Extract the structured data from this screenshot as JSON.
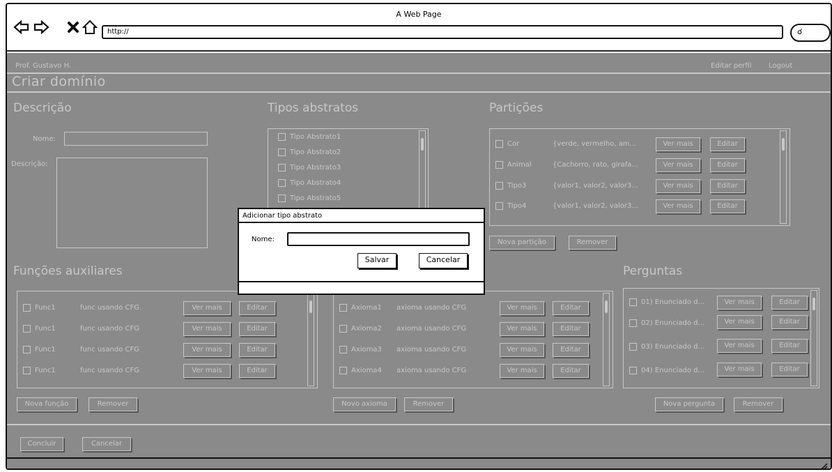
{
  "browser": {
    "title": "A Web Page",
    "url": "http://",
    "icons": [
      "back-arrow-icon",
      "forward-arrow-icon",
      "close-icon",
      "home-icon",
      "search-icon"
    ]
  },
  "header": {
    "user": "Prof. Gustavo H.",
    "edit_profile": "Editar perfil",
    "logout": "Logout"
  },
  "page": {
    "title": "Criar domínio"
  },
  "descricao": {
    "heading": "Descrição",
    "name_label": "Nome:",
    "desc_label": "Descrição:"
  },
  "tipos": {
    "heading": "Tipos abstratos",
    "items": [
      "Tipo Abstrato1",
      "Tipo Abstrato2",
      "Tipo Abstrato3",
      "Tipo Abstrato4",
      "Tipo Abstrato5"
    ]
  },
  "particoes": {
    "heading": "Partições",
    "items": [
      {
        "name": "Cor",
        "values": "{verde, vermelho, am...",
        "more": "Ver mais",
        "edit": "Editar"
      },
      {
        "name": "Animal",
        "values": "{Cachorro, rato, girafa...",
        "more": "Ver mais",
        "edit": "Editar"
      },
      {
        "name": "Tipo3",
        "values": "{valor1, valor2, valor3...",
        "more": "Ver mais",
        "edit": "Editar"
      },
      {
        "name": "Tipo4",
        "values": "{valor1, valor2, valor3...",
        "more": "Ver mais",
        "edit": "Editar"
      }
    ],
    "new_button": "Nova partição",
    "remove_button": "Remover"
  },
  "funcoes": {
    "heading": "Funções auxiliares",
    "items": [
      {
        "name": "Func1",
        "desc": "func usando CFG",
        "more": "Ver mais",
        "edit": "Editar"
      },
      {
        "name": "Func1",
        "desc": "func usando CFG",
        "more": "Ver mais",
        "edit": "Editar"
      },
      {
        "name": "Func1",
        "desc": "func usando CFG",
        "more": "Ver mais",
        "edit": "Editar"
      },
      {
        "name": "Func1",
        "desc": "func usando CFG",
        "more": "Ver mais",
        "edit": "Editar"
      }
    ],
    "new_button": "Nova função",
    "remove_button": "Remover"
  },
  "axiomas": {
    "items": [
      {
        "name": "Axioma1",
        "desc": "axioma usando CFG",
        "more": "Ver mais",
        "edit": "Editar"
      },
      {
        "name": "Axioma2",
        "desc": "axioma usando CFG",
        "more": "Ver mais",
        "edit": "Editar"
      },
      {
        "name": "Axioma3",
        "desc": "axioma usando CFG",
        "more": "Ver mais",
        "edit": "Editar"
      },
      {
        "name": "Axioma4",
        "desc": "axioma usando CFG",
        "more": "Ver mais",
        "edit": "Editar"
      }
    ],
    "new_button": "Novo axioma",
    "remove_button": "Remover"
  },
  "perguntas": {
    "heading": "Perguntas",
    "items": [
      {
        "name": "01) Enunciado d...",
        "more": "Ver mais",
        "edit": "Editar"
      },
      {
        "name": "02) Enunciado d...",
        "more": "Ver mais",
        "edit": "Editar"
      },
      {
        "name": "03) Enunciado d...",
        "more": "Ver mais",
        "edit": "Editar"
      },
      {
        "name": "04) Enunciado d...",
        "more": "Ver mais",
        "edit": "Editar"
      }
    ],
    "new_button": "Nova pergunta",
    "remove_button": "Remover"
  },
  "footer": {
    "conclude": "Concluir",
    "cancel": "Cancelar"
  },
  "dialog": {
    "title": "Adicionar tipo abstrato",
    "name_label": "Nome:",
    "name_value": "",
    "save": "Salvar",
    "cancel": "Cancelar"
  }
}
